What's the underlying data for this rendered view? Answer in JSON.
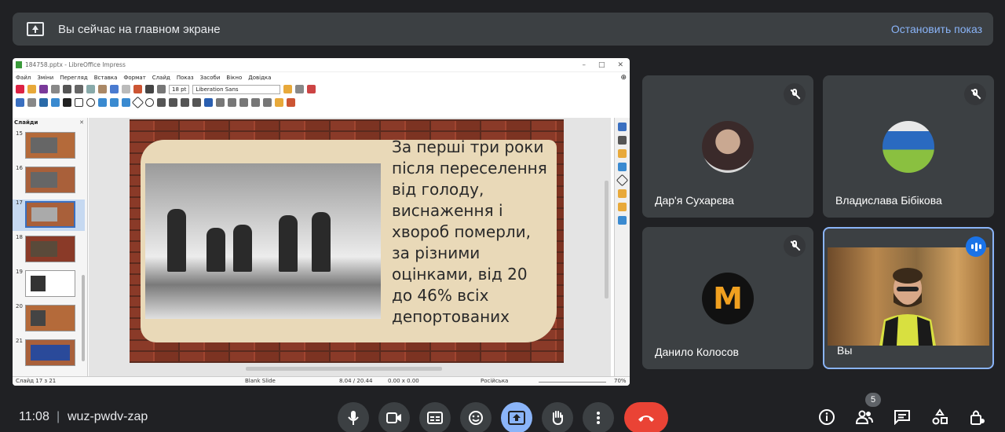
{
  "banner": {
    "title": "Вы сейчас на главном экране",
    "stop_label": "Остановить показ"
  },
  "lo": {
    "window_title": "184758.pptx - LibreOffice Impress",
    "menu": [
      "Файл",
      "Зміни",
      "Перегляд",
      "Вставка",
      "Формат",
      "Слайд",
      "Показ",
      "Засоби",
      "Вікно",
      "Довідка"
    ],
    "font_size": "18 pt",
    "font_name": "Liberation Sans",
    "panel_title": "Слайди",
    "thumb_numbers": [
      "15",
      "16",
      "17",
      "18",
      "19",
      "20",
      "21"
    ],
    "slide_lines": [
      "За перші три роки",
      "після переселення",
      "від голоду,",
      "виснаження і",
      "хвороб померли,",
      "за різними",
      "оцінками, від 20",
      "до 46% всіх",
      "депортованих"
    ],
    "status": {
      "slide_pos": "Слайд 17 з 21",
      "layout": "Blank Slide",
      "coords": "8.04 / 20.44",
      "size": "0.00 x 0.00",
      "language": "Російська",
      "zoom": "70%"
    }
  },
  "participants": [
    {
      "name": "Дар'я Сухарєва",
      "muted": true
    },
    {
      "name": "Владислава Бібікова",
      "muted": true
    },
    {
      "name": "Данило Колосов",
      "muted": true
    },
    {
      "name": "Вы",
      "speaking": true
    }
  ],
  "bottom": {
    "time": "11:08",
    "separator": "|",
    "meeting_code": "wuz-pwdv-zap",
    "people_count": "5"
  },
  "colors": {
    "background": "#202124",
    "tile": "#3c4043",
    "accent": "#8ab4f8",
    "hangup": "#ea4335",
    "speaking": "#1a73e8"
  }
}
